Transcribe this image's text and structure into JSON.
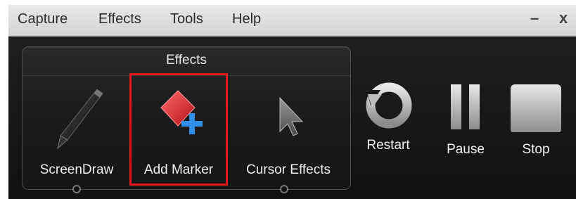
{
  "menubar": {
    "items": [
      "Capture",
      "Effects",
      "Tools",
      "Help"
    ],
    "minimize": "–",
    "close": "x"
  },
  "effects_panel": {
    "title": "Effects",
    "tools": [
      {
        "label": "ScreenDraw",
        "icon": "pen-icon"
      },
      {
        "label": "Add Marker",
        "icon": "add-marker-icon",
        "selected": true
      },
      {
        "label": "Cursor Effects",
        "icon": "cursor-icon"
      }
    ]
  },
  "controls": [
    {
      "label": "Restart",
      "icon": "restart-icon"
    },
    {
      "label": "Pause",
      "icon": "pause-icon"
    },
    {
      "label": "Stop",
      "icon": "stop-icon"
    }
  ],
  "colors": {
    "selection": "#e3171c",
    "marker_red": "#e0262b",
    "plus_blue": "#2f8fe6"
  }
}
